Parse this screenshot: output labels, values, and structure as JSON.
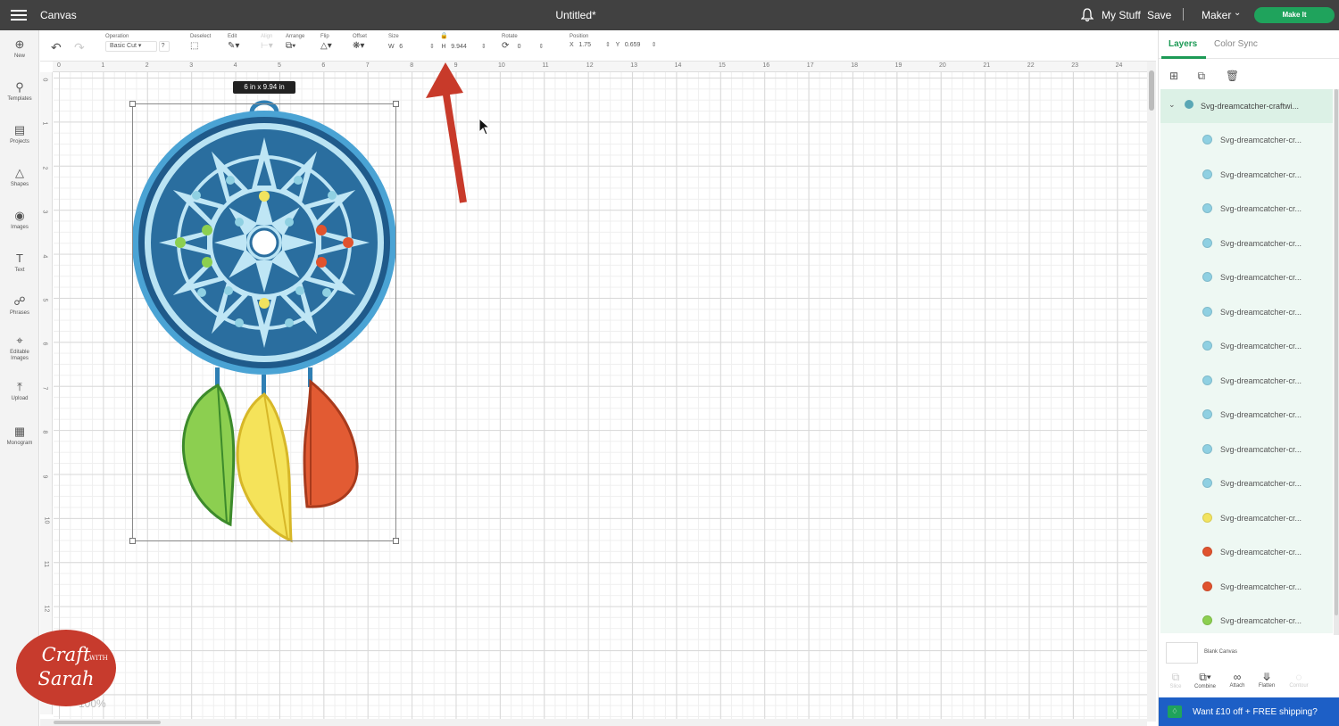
{
  "topbar": {
    "app_name": "Canvas",
    "document_title": "Untitled*",
    "my_stuff": "My Stuff",
    "save": "Save",
    "separator": "|",
    "machine": "Maker",
    "make_it": "Make It"
  },
  "sidebar": {
    "items": [
      {
        "label": "New",
        "icon": "plus-icon"
      },
      {
        "label": "Templates",
        "icon": "shirt-icon"
      },
      {
        "label": "Projects",
        "icon": "clipboard-icon"
      },
      {
        "label": "Shapes",
        "icon": "shapes-icon"
      },
      {
        "label": "Images",
        "icon": "bulb-icon"
      },
      {
        "label": "Text",
        "icon": "text-icon"
      },
      {
        "label": "Phrases",
        "icon": "speech-icon"
      },
      {
        "label": "Editable Images",
        "icon": "crop-icon"
      },
      {
        "label": "Upload",
        "icon": "upload-icon"
      },
      {
        "label": "Monogram",
        "icon": "monogram-icon"
      }
    ]
  },
  "toolbar": {
    "operation_label": "Operation",
    "operation_value": "Basic Cut",
    "help": "?",
    "deselect_label": "Deselect",
    "edit_label": "Edit",
    "align_label": "Align",
    "arrange_label": "Arrange",
    "flip_label": "Flip",
    "offset_label": "Offset",
    "size_label": "Size",
    "w_label": "W",
    "w_value": "6",
    "h_label": "H",
    "h_value": "9.944",
    "rotate_label": "Rotate",
    "rotate_value": "0",
    "position_label": "Position",
    "x_label": "X",
    "x_value": "1.75",
    "y_label": "Y",
    "y_value": "0.659"
  },
  "rulers": {
    "horizontal": [
      "0",
      "1",
      "2",
      "3",
      "4",
      "5",
      "6",
      "7",
      "8",
      "9",
      "10",
      "11",
      "12",
      "13",
      "14",
      "15",
      "16",
      "17",
      "18",
      "19",
      "20",
      "21",
      "22",
      "23",
      "24"
    ],
    "vertical": [
      "0",
      "1",
      "2",
      "3",
      "4",
      "5",
      "6",
      "7",
      "8",
      "9",
      "10",
      "11",
      "12"
    ]
  },
  "canvas": {
    "size_tooltip": "6 in x 9.94 in",
    "zoom": "100%"
  },
  "right_panel": {
    "tabs": [
      "Layers",
      "Color Sync"
    ],
    "group_label": "Svg-dreamcatcher-craftwi...",
    "group_color": "#5aa7b5",
    "layers": [
      {
        "name": "Svg-dreamcatcher-cr...",
        "color": "#8fd0e2"
      },
      {
        "name": "Svg-dreamcatcher-cr...",
        "color": "#8fd0e2"
      },
      {
        "name": "Svg-dreamcatcher-cr...",
        "color": "#8fd0e2"
      },
      {
        "name": "Svg-dreamcatcher-cr...",
        "color": "#8fd0e2"
      },
      {
        "name": "Svg-dreamcatcher-cr...",
        "color": "#8fd0e2"
      },
      {
        "name": "Svg-dreamcatcher-cr...",
        "color": "#8fd0e2"
      },
      {
        "name": "Svg-dreamcatcher-cr...",
        "color": "#8fd0e2"
      },
      {
        "name": "Svg-dreamcatcher-cr...",
        "color": "#8fd0e2"
      },
      {
        "name": "Svg-dreamcatcher-cr...",
        "color": "#8fd0e2"
      },
      {
        "name": "Svg-dreamcatcher-cr...",
        "color": "#8fd0e2"
      },
      {
        "name": "Svg-dreamcatcher-cr...",
        "color": "#8fd0e2"
      },
      {
        "name": "Svg-dreamcatcher-cr...",
        "color": "#f2e35e"
      },
      {
        "name": "Svg-dreamcatcher-cr...",
        "color": "#e0532e"
      },
      {
        "name": "Svg-dreamcatcher-cr...",
        "color": "#e0532e"
      },
      {
        "name": "Svg-dreamcatcher-cr...",
        "color": "#8ccf50"
      }
    ],
    "blank_canvas": "Blank Canvas",
    "bottom_actions": [
      "Slice",
      "Combine",
      "Attach",
      "Flatten",
      "Contour"
    ],
    "promo": "Want £10 off + FREE shipping?"
  },
  "watermark": {
    "line1": "Craft",
    "with": "WITH",
    "line2": "Sarah"
  },
  "colors": {
    "accent": "#1d9a56",
    "topbar": "#414141",
    "promo": "#1d5fc6",
    "arrow": "#c83a2a"
  }
}
